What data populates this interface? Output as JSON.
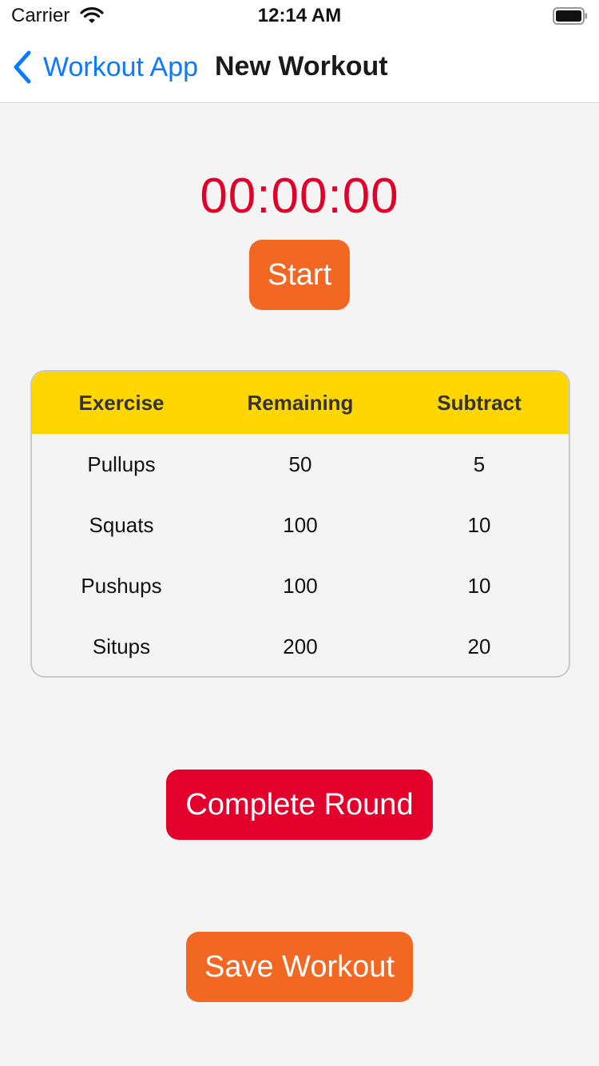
{
  "status_bar": {
    "carrier": "Carrier",
    "time": "12:14 AM",
    "icons": [
      "wifi-icon",
      "battery-icon"
    ]
  },
  "nav": {
    "back_label": "Workout App",
    "title": "New Workout",
    "accent_color": "#0a7aff"
  },
  "timer": {
    "value": "00:00:00",
    "color": "#e0002a"
  },
  "buttons": {
    "start_label": "Start",
    "complete_label": "Complete Round",
    "save_label": "Save Workout"
  },
  "table": {
    "columns": [
      "Exercise",
      "Remaining",
      "Subtract"
    ],
    "header_color": "#ffd600",
    "rows": [
      [
        "Pullups",
        "50",
        "5"
      ],
      [
        "Squats",
        "100",
        "10"
      ],
      [
        "Pushups",
        "100",
        "10"
      ],
      [
        "Situps",
        "200",
        "20"
      ]
    ]
  },
  "colors": {
    "orange": "#f26722",
    "red": "#e3002a",
    "background": "#f4f4f4"
  }
}
